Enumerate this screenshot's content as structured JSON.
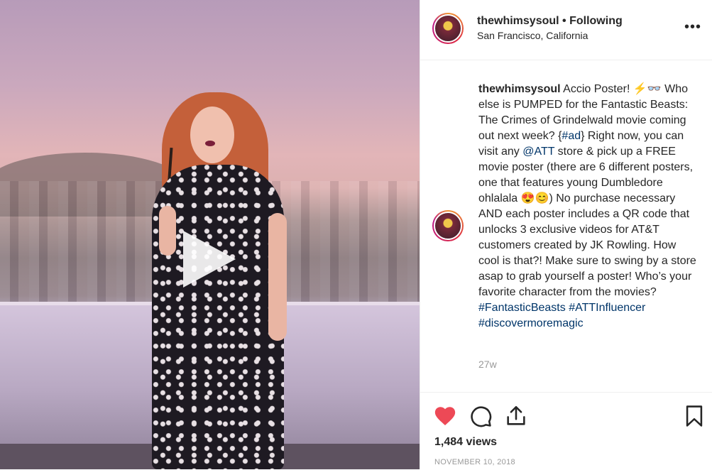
{
  "post": {
    "media_type": "video",
    "play_icon": "play-icon"
  },
  "header": {
    "username": "thewhimsysoul",
    "separator": "•",
    "follow_status": "Following",
    "location": "San Francisco, California",
    "more_icon": "more-icon",
    "more_label": "•••"
  },
  "caption": {
    "username": "thewhimsysoul",
    "segments": [
      {
        "t": "Accio Poster! ⚡👓 Who else is PUMPED for the Fantastic Beasts: The Crimes of Grindelwald movie coming out next week? {",
        "link": false
      },
      {
        "t": "#ad",
        "link": true
      },
      {
        "t": "} Right now, you can visit any ",
        "link": false
      },
      {
        "t": "@ATT",
        "link": true
      },
      {
        "t": " store & pick up a FREE movie poster (there are 6 different posters, one that features young Dumbledore ohlalala 😍😊) No purchase necessary AND each poster includes a QR code that unlocks 3 exclusive videos for AT&T customers created by JK Rowling. How cool is that?! Make sure to swing by a store asap to grab yourself a poster! Who’s your favorite character from the movies? ",
        "link": false
      },
      {
        "t": "#FantasticBeasts",
        "link": true
      },
      {
        "t": " ",
        "link": false
      },
      {
        "t": "#ATTInfluencer",
        "link": true
      },
      {
        "t": " ",
        "link": false
      },
      {
        "t": "#discovermoremagic",
        "link": true
      }
    ],
    "age": "27w"
  },
  "actions": {
    "like_icon": "heart-icon",
    "comment_icon": "comment-icon",
    "share_icon": "share-icon",
    "save_icon": "bookmark-icon",
    "liked": true,
    "like_color": "#ed4956",
    "views": "1,484 views",
    "date": "NOVEMBER 10, 2018"
  }
}
